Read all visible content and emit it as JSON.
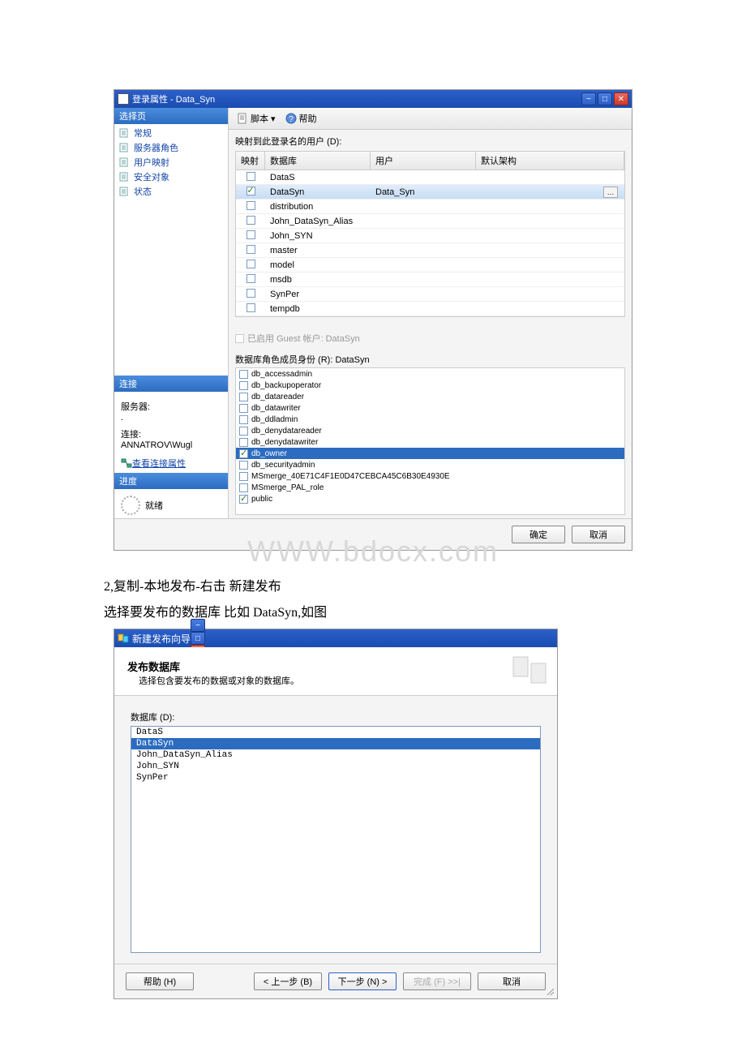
{
  "dialog1": {
    "title": "登录属性 - Data_Syn",
    "leftPanel": {
      "selectHeader": "选择页",
      "treeItems": [
        "常规",
        "服务器角色",
        "用户映射",
        "安全对象",
        "状态"
      ],
      "connHeader": "连接",
      "serverLabel": "服务器:",
      "serverValue": ".",
      "connLabel": "连接:",
      "connValue": "ANNATROV\\Wugl",
      "viewConnLink": "查看连接属性",
      "progressHeader": "进度",
      "readyLabel": "就绪"
    },
    "toolbar": {
      "script": "脚本",
      "help": "帮助"
    },
    "mapping": {
      "label": "映射到此登录名的用户 (D):",
      "headers": {
        "map": "映射",
        "db": "数据库",
        "user": "用户",
        "schema": "默认架构"
      },
      "rows": [
        {
          "checked": false,
          "db": "DataS",
          "user": "",
          "selected": false
        },
        {
          "checked": true,
          "db": "DataSyn",
          "user": "Data_Syn",
          "selected": true
        },
        {
          "checked": false,
          "db": "distribution",
          "user": "",
          "selected": false
        },
        {
          "checked": false,
          "db": "John_DataSyn_Alias",
          "user": "",
          "selected": false
        },
        {
          "checked": false,
          "db": "John_SYN",
          "user": "",
          "selected": false
        },
        {
          "checked": false,
          "db": "master",
          "user": "",
          "selected": false
        },
        {
          "checked": false,
          "db": "model",
          "user": "",
          "selected": false
        },
        {
          "checked": false,
          "db": "msdb",
          "user": "",
          "selected": false
        },
        {
          "checked": false,
          "db": "SynPer",
          "user": "",
          "selected": false
        },
        {
          "checked": false,
          "db": "tempdb",
          "user": "",
          "selected": false
        }
      ]
    },
    "guestLabel": "已启用 Guest 帐户: DataSyn",
    "rolesLabel": "数据库角色成员身份 (R): DataSyn",
    "roles": [
      {
        "name": "db_accessadmin",
        "checked": false,
        "hl": false
      },
      {
        "name": "db_backupoperator",
        "checked": false,
        "hl": false
      },
      {
        "name": "db_datareader",
        "checked": false,
        "hl": false
      },
      {
        "name": "db_datawriter",
        "checked": false,
        "hl": false
      },
      {
        "name": "db_ddladmin",
        "checked": false,
        "hl": false
      },
      {
        "name": "db_denydatareader",
        "checked": false,
        "hl": false
      },
      {
        "name": "db_denydatawriter",
        "checked": false,
        "hl": false
      },
      {
        "name": "db_owner",
        "checked": true,
        "hl": true
      },
      {
        "name": "db_securityadmin",
        "checked": false,
        "hl": false
      },
      {
        "name": "MSmerge_40E71C4F1E0D47CEBCA45C6B30E4930E",
        "checked": false,
        "hl": false
      },
      {
        "name": "MSmerge_PAL_role",
        "checked": false,
        "hl": false
      },
      {
        "name": "public",
        "checked": true,
        "hl": false
      }
    ],
    "footer": {
      "ok": "确定",
      "cancel": "取消"
    }
  },
  "watermark": "WWW.bdocx.com",
  "text1": "2,复制-本地发布-右击 新建发布",
  "text2": "选择要发布的数据库 比如 DataSyn,如图",
  "dialog2": {
    "title": "新建发布向导",
    "wizardTitle": "发布数据库",
    "wizardSub": "选择包含要发布的数据或对象的数据库。",
    "listLabel": "数据库 (D):",
    "items": [
      {
        "name": "DataS",
        "selected": false
      },
      {
        "name": "DataSyn",
        "selected": true
      },
      {
        "name": "John_DataSyn_Alias",
        "selected": false
      },
      {
        "name": "John_SYN",
        "selected": false
      },
      {
        "name": "SynPer",
        "selected": false
      }
    ],
    "footer": {
      "help": "帮助 (H)",
      "back": "< 上一步 (B)",
      "next": "下一步 (N) >",
      "finish": "完成 (F) >>|",
      "cancel": "取消"
    }
  }
}
